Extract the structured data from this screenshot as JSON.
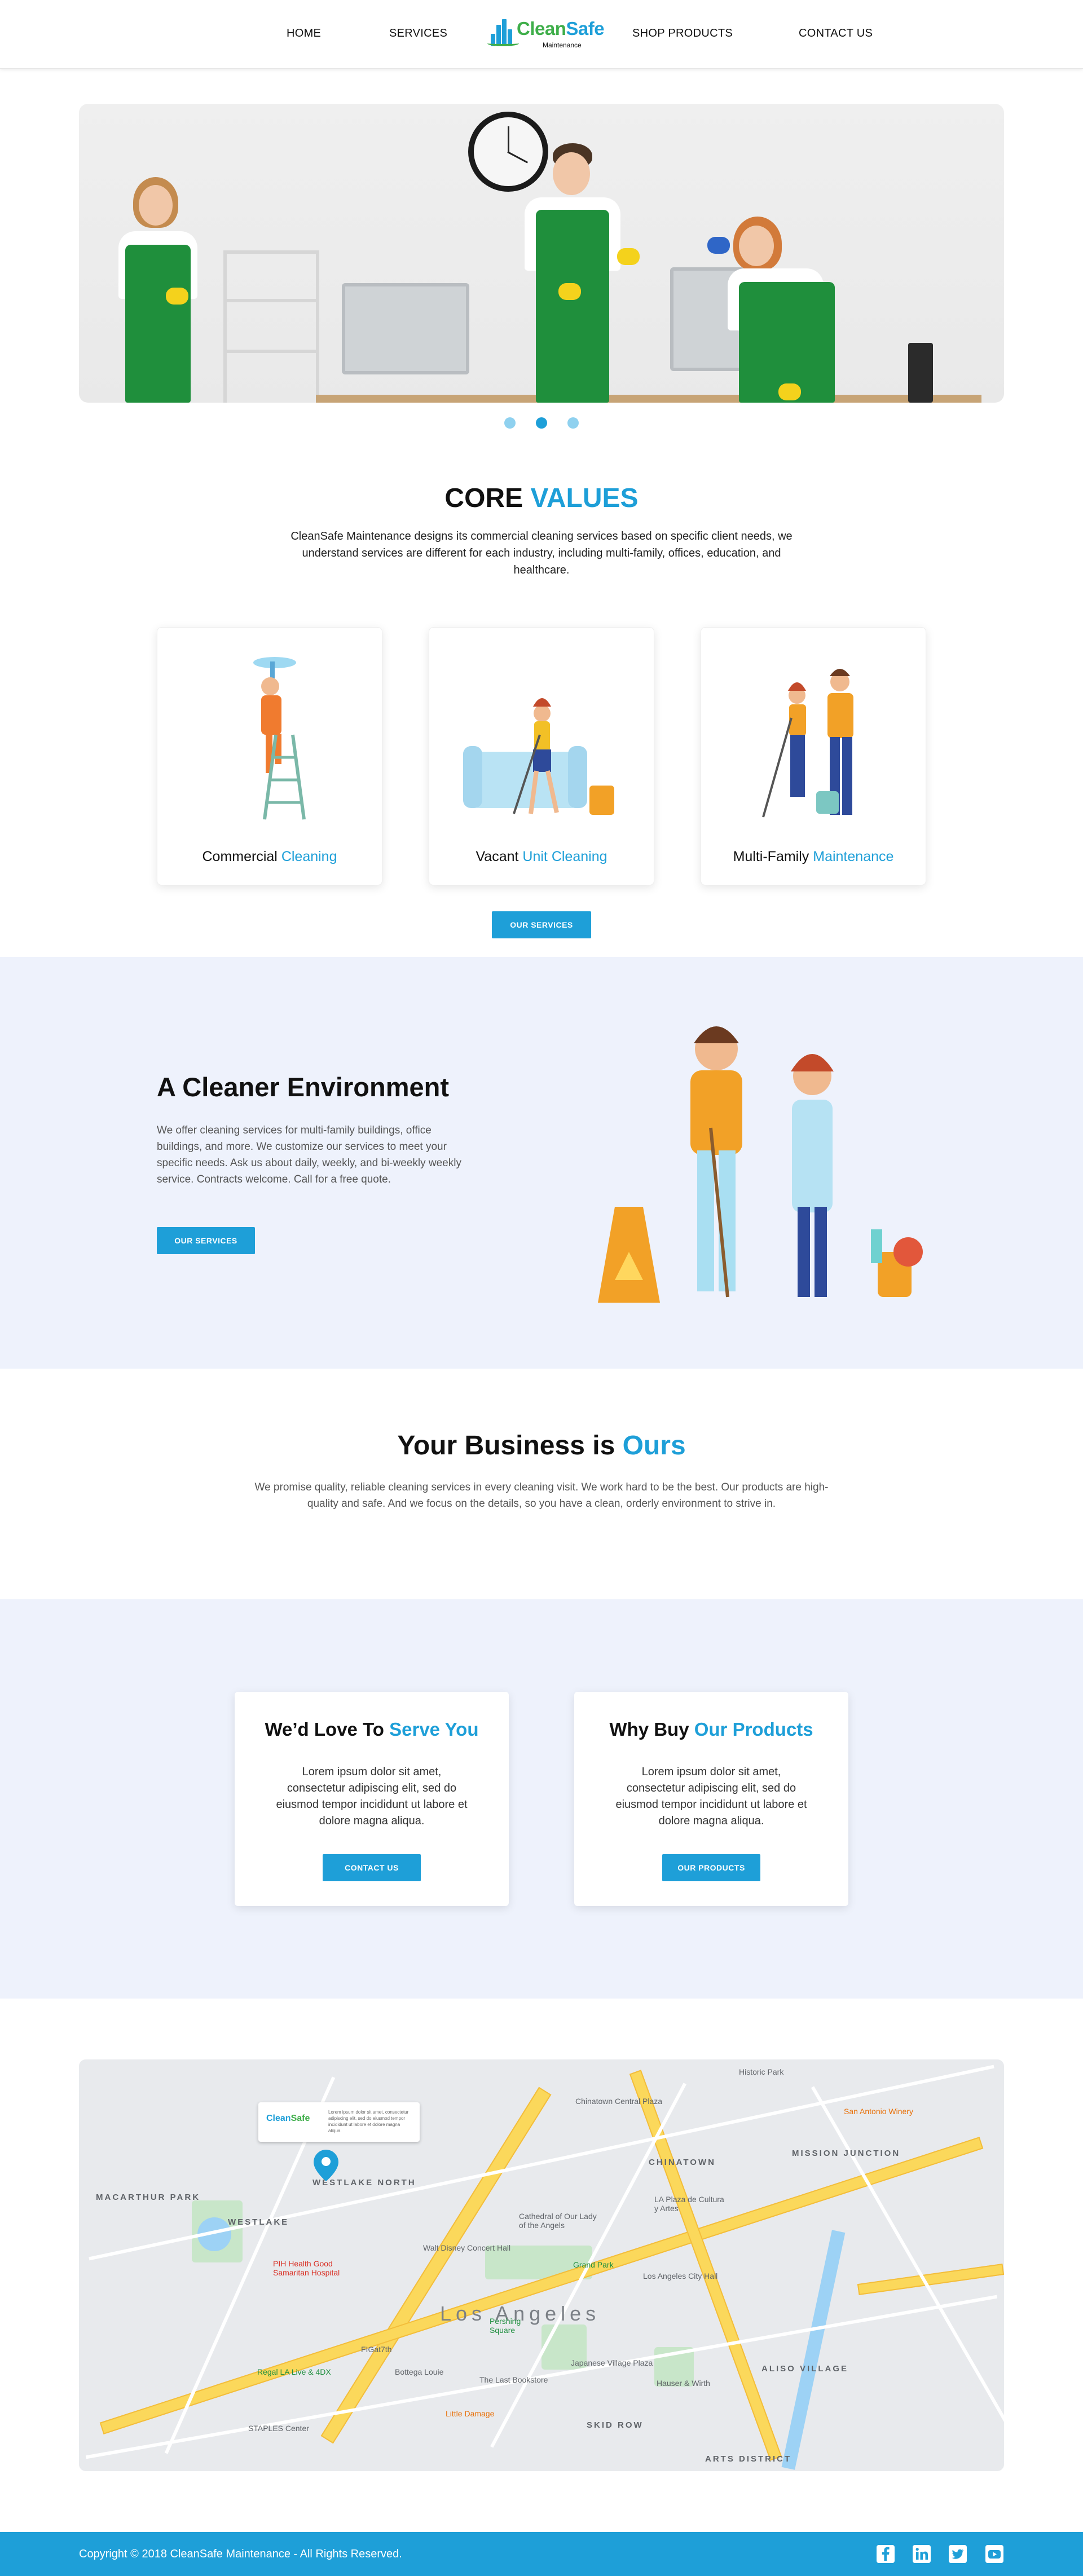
{
  "nav": {
    "home": "HOME",
    "services": "SERVICES",
    "shop": "SHOP PRODUCTS",
    "contact": "CONTACT US",
    "logo_part1": "Clean",
    "logo_part2": "Safe",
    "logo_sub": "Maintenance"
  },
  "hero": {
    "slides": 3,
    "active_slide": 2
  },
  "core": {
    "title_a": "CORE",
    "title_b": "VALUES",
    "text": "CleanSafe Maintenance designs its commercial cleaning services based on specific client needs, we understand services are different for each industry, including multi-family, offices, education, and healthcare.",
    "cards": [
      {
        "a": "Commercial",
        "b": "Cleaning"
      },
      {
        "a": "Vacant",
        "b": "Unit Cleaning"
      },
      {
        "a": "Multi-Family",
        "b": "Maintenance"
      }
    ],
    "button": "OUR SERVICES"
  },
  "env": {
    "title": "A Cleaner Environment",
    "text": "We offer cleaning services for multi-family buildings, office buildings, and more. We customize our services to meet your specific needs. Ask us about daily, weekly, and bi-weekly weekly service. Contracts welcome. Call for a free quote.",
    "button": "OUR SERVICES"
  },
  "business": {
    "title_a": "Your Business is",
    "title_b": "Ours",
    "text": "We promise quality, reliable cleaning services in every cleaning visit. We work hard to be the best. Our products are high-quality and safe. And we focus on the details, so you have a clean, orderly environment to strive in."
  },
  "cta": {
    "serve": {
      "a": "We’d Love To",
      "b": "Serve You",
      "text": "Lorem ipsum dolor sit amet, consectetur adipiscing elit, sed do eiusmod tempor incididunt ut labore et dolore magna aliqua.",
      "button": "CONTACT US"
    },
    "buy": {
      "a": "Why Buy",
      "b": "Our Products",
      "text": "Lorem ipsum dolor sit amet, consectetur adipiscing elit, sed do eiusmod tempor incididunt ut labore et dolore magna aliqua.",
      "button": "OUR PRODUCTS"
    }
  },
  "map": {
    "infobox_logo_a": "Clean",
    "infobox_logo_b": "Safe",
    "infobox_text": "Lorem ipsum dolor sit amet, consectetur adipiscing elit, sed do eiusmod tempor incididunt ut labore et dolore magna aliqua.",
    "city": "Los Angeles",
    "areas": [
      "MACARTHUR PARK",
      "WESTLAKE",
      "WESTLAKE NORTH",
      "CHINATOWN",
      "MISSION JUNCTION",
      "ALISO VILLAGE",
      "SKID ROW",
      "ARTS DISTRICT"
    ],
    "pois": [
      "Chinatown Central Plaza",
      "San Antonio Winery",
      "Walt Disney Concert Hall",
      "Grand Park",
      "Los Angeles City Hall",
      "PIH Health Good Samaritan Hospital",
      "Pershing Square",
      "Regal LA Live & 4DX",
      "STAPLES Center",
      "Little Damage",
      "Japanese Village Plaza",
      "The Last Bookstore",
      "Bottega Louie",
      "Cathedral of Our Lady of the Angels",
      "LA Plaza de Cultura y Artes",
      "Historic Park",
      "Hauser & Wirth",
      "FIGat7th"
    ]
  },
  "footer": {
    "copyright": "Copyright © 2018 CleanSafe Maintenance - All Rights Reserved.",
    "social": [
      "facebook-icon",
      "linkedin-icon",
      "twitter-icon",
      "youtube-icon"
    ]
  },
  "colors": {
    "accent": "#1e9fd8",
    "logo_green": "#3fae4a",
    "band": "#eef2fc"
  }
}
